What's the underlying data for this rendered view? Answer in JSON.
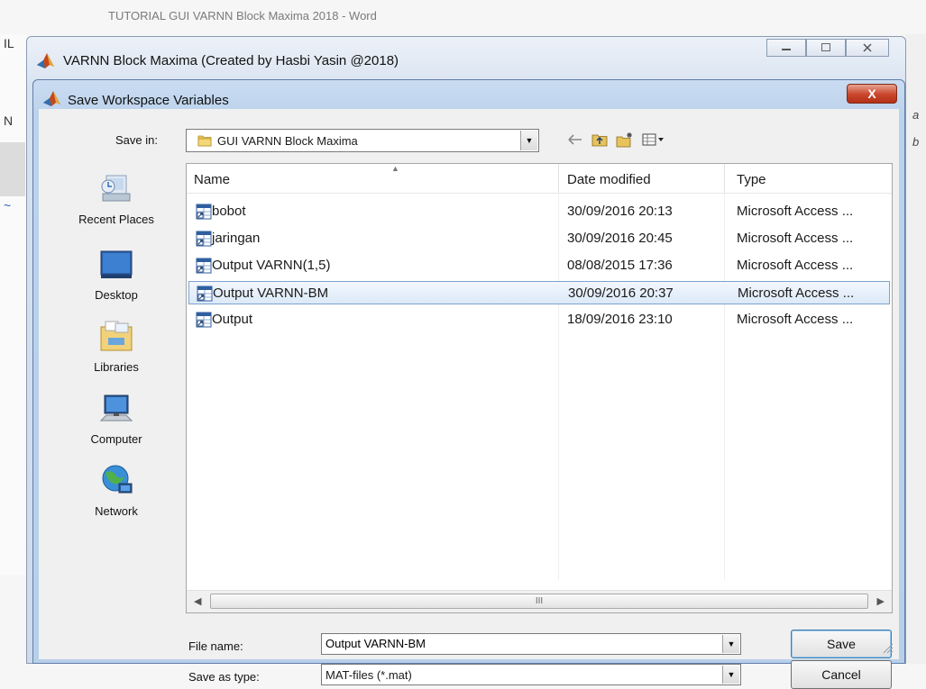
{
  "word": {
    "title": "TUTORIAL GUI VARNN Block Maxima 2018 - Word",
    "left_glyphs": [
      "IL",
      "N",
      "~"
    ],
    "right_glyphs": [
      "a",
      "b"
    ]
  },
  "app_window": {
    "title": "VARNN Block Maxima (Created by Hasbi Yasin @2018)",
    "buttons": [
      "minimize",
      "maximize",
      "close"
    ]
  },
  "dialog": {
    "title": "Save Workspace Variables",
    "close_glyph": "X",
    "save_in_label": "Save in:",
    "save_in_value": "GUI VARNN Block Maxima",
    "toolbar_icons": [
      "back-arrow-icon",
      "up-folder-icon",
      "new-folder-icon",
      "view-menu-icon"
    ],
    "places": [
      {
        "label": "Recent Places",
        "icon": "recent-places-icon"
      },
      {
        "label": "Desktop",
        "icon": "desktop-icon"
      },
      {
        "label": "Libraries",
        "icon": "libraries-icon"
      },
      {
        "label": "Computer",
        "icon": "computer-icon"
      },
      {
        "label": "Network",
        "icon": "network-icon"
      }
    ],
    "columns": [
      "Name",
      "Date modified",
      "Type"
    ],
    "files": [
      {
        "name": "bobot",
        "date": "30/09/2016 20:13",
        "type": "Microsoft Access ..."
      },
      {
        "name": "jaringan",
        "date": "30/09/2016 20:45",
        "type": "Microsoft Access ..."
      },
      {
        "name": "Output VARNN(1,5)",
        "date": "08/08/2015 17:36",
        "type": "Microsoft Access ..."
      },
      {
        "name": "Output VARNN-BM",
        "date": "30/09/2016 20:37",
        "type": "Microsoft Access ..."
      },
      {
        "name": "Output",
        "date": "18/09/2016 23:10",
        "type": "Microsoft Access ..."
      }
    ],
    "selected_file_index": 3,
    "scroll_thumb_glyph": "III",
    "file_name_label": "File name:",
    "file_name_value": "Output VARNN-BM",
    "save_as_type_label": "Save as type:",
    "save_as_type_value": "MAT-files (*.mat)",
    "save_button": "Save",
    "cancel_button": "Cancel"
  },
  "colors": {
    "dialog_frame": "#b8cfea",
    "close_red": "#c9452b",
    "selection_border": "#7da2ce"
  }
}
